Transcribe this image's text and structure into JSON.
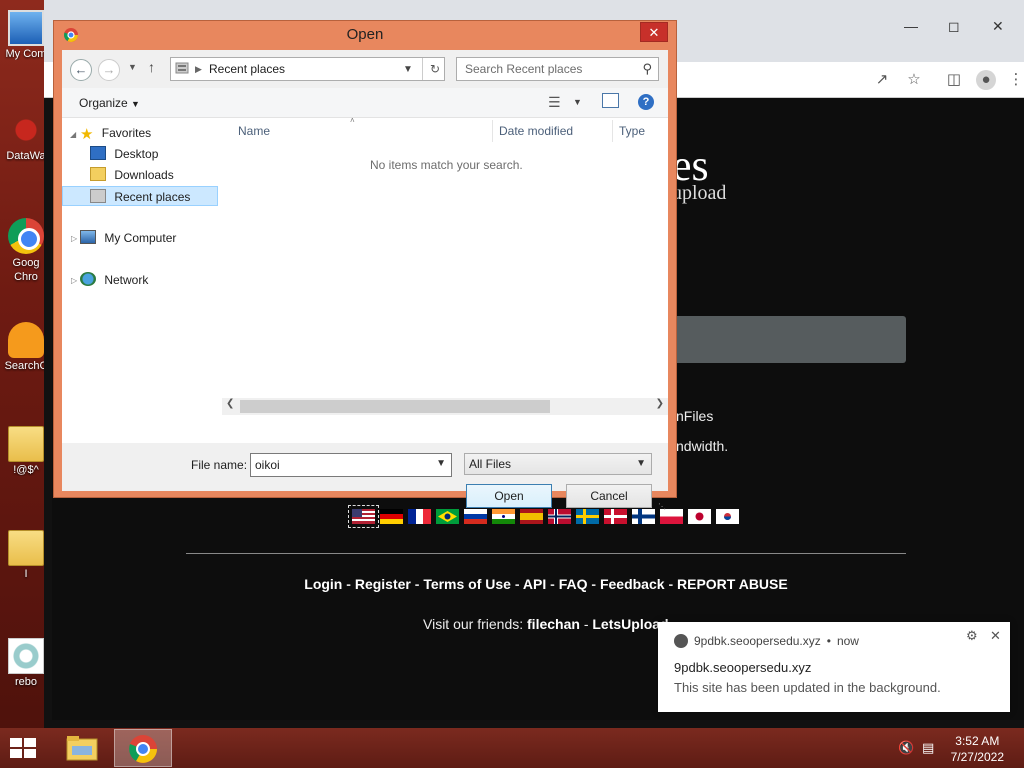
{
  "desktop": {
    "icons": [
      {
        "label": "My Com",
        "kind": "pc"
      },
      {
        "label": "DataWa",
        "kind": "datawave"
      },
      {
        "label": "Goog Chro",
        "kind": "chrome"
      },
      {
        "label": "SearchC",
        "kind": "search"
      },
      {
        "label": "!@$^",
        "kind": "folder"
      },
      {
        "label": "I",
        "kind": "folder"
      },
      {
        "label": "rebo",
        "kind": "gear"
      }
    ]
  },
  "browser": {
    "page": {
      "title_fragment": "es",
      "subtitle_fragment": "upload",
      "line1_fragment": "nFiles",
      "line2_fragment": "ndwidth.",
      "flags": [
        "us",
        "de",
        "fr",
        "br",
        "ru",
        "in",
        "es",
        "no",
        "se",
        "dk",
        "fi",
        "pl",
        "jp",
        "kr"
      ],
      "footer_links": [
        "Login",
        "Register",
        "Terms of Use",
        "API",
        "FAQ",
        "Feedback",
        "REPORT ABUSE"
      ],
      "footer_sep": "-",
      "friends_prefix": "Visit our friends:",
      "friends": [
        "filechan",
        "LetsUpload"
      ]
    }
  },
  "notification": {
    "site": "9pdbk.seoopersedu.xyz",
    "time": "now",
    "title": "9pdbk.seoopersedu.xyz",
    "message": "This site has been updated in the background."
  },
  "dialog": {
    "title": "Open",
    "close_glyph": "✕",
    "address": "Recent places",
    "search_placeholder": "Search Recent places",
    "organize_label": "Organize",
    "tree": {
      "favorites": "Favorites",
      "desktop": "Desktop",
      "downloads": "Downloads",
      "recent": "Recent places",
      "computer": "My Computer",
      "network": "Network"
    },
    "columns": {
      "name": "Name",
      "date": "Date modified",
      "type": "Type"
    },
    "empty_message": "No items match your search.",
    "filename_label": "File name:",
    "filename_value": "oikoi",
    "filetype_value": "All Files",
    "open_label": "Open",
    "cancel_label": "Cancel"
  },
  "taskbar": {
    "time": "3:52 AM",
    "date": "7/27/2022"
  },
  "colors": {
    "dialog_frame": "#e8875e",
    "close_button": "#c7302a",
    "selection": "#cce8ff",
    "taskbar": "#6b2219"
  }
}
